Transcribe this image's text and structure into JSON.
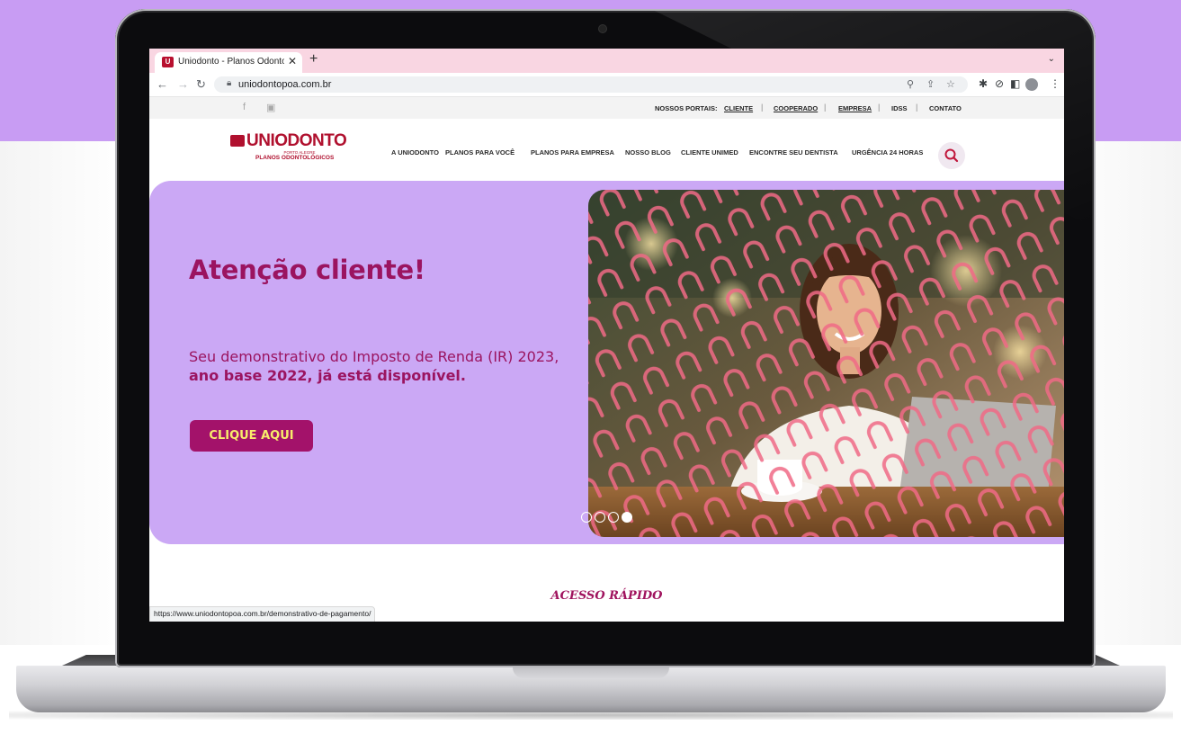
{
  "browser": {
    "tab_title": "Uniodonto - Planos Odontológ",
    "tab_favicon": "U",
    "tab_close": "✕",
    "new_tab": "+",
    "tab_menu": "⌄",
    "url": "uniodontopoa.com.br",
    "status_url": "https://www.uniodontopoa.com.br/demonstrativo-de-pagamento/"
  },
  "topbar": {
    "portais_label": "NOSSOS PORTAIS:",
    "links": [
      "CLIENTE",
      "COOPERADO",
      "EMPRESA",
      "IDSS",
      "CONTATO"
    ],
    "social_icons": [
      "facebook-icon",
      "instagram-icon"
    ]
  },
  "logo": {
    "name": "UNIODONTO",
    "city": "PORTO ALEGRE",
    "tagline": "PLANOS ODONTOLÓGICOS"
  },
  "nav": {
    "items": [
      "A UNIODONTO",
      "PLANOS PARA VOCÊ",
      "PLANOS PARA EMPRESA",
      "NOSSO BLOG",
      "CLIENTE UNIMED",
      "ENCONTRE SEU DENTISTA",
      "URGÊNCIA 24 HORAS"
    ]
  },
  "hero": {
    "title": "Atenção cliente!",
    "text_line1": "Seu demonstrativo do Imposto de Renda (IR) 2023,",
    "text_line2": "ano base 2022, já está disponível.",
    "cta": "CLIQUE AQUI",
    "slides_count": 4,
    "active_slide": 4
  },
  "quick_access": {
    "title": "ACESSO RÁPIDO"
  },
  "colors": {
    "brand": "#b0102e",
    "hero_bg": "#cba8f5",
    "hero_text": "#9b1460",
    "cta_bg": "#a3126a",
    "cta_text": "#f7ec6b",
    "page_backdrop": "#c89cf3"
  }
}
